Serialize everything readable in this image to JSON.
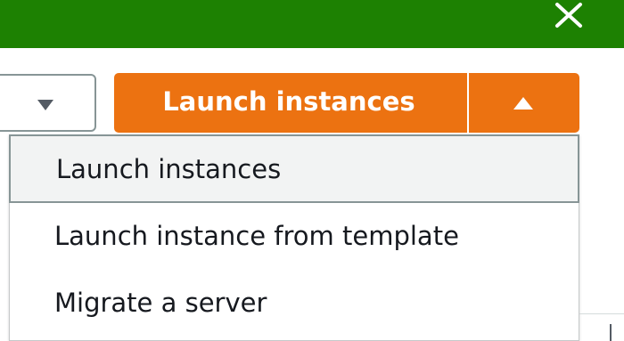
{
  "banner": {
    "color": "#1d8102",
    "close_icon": "close-icon"
  },
  "toolbar": {
    "left_dropdown_icon": "caret-down-icon",
    "launch_button_label": "Launch instances",
    "launch_button_color": "#ec7211",
    "split_icon": "caret-up-icon"
  },
  "menu": {
    "items": [
      {
        "label": "Launch instances",
        "hovered": true
      },
      {
        "label": "Launch instance from template",
        "hovered": false
      },
      {
        "label": "Migrate a server",
        "hovered": false
      }
    ]
  }
}
